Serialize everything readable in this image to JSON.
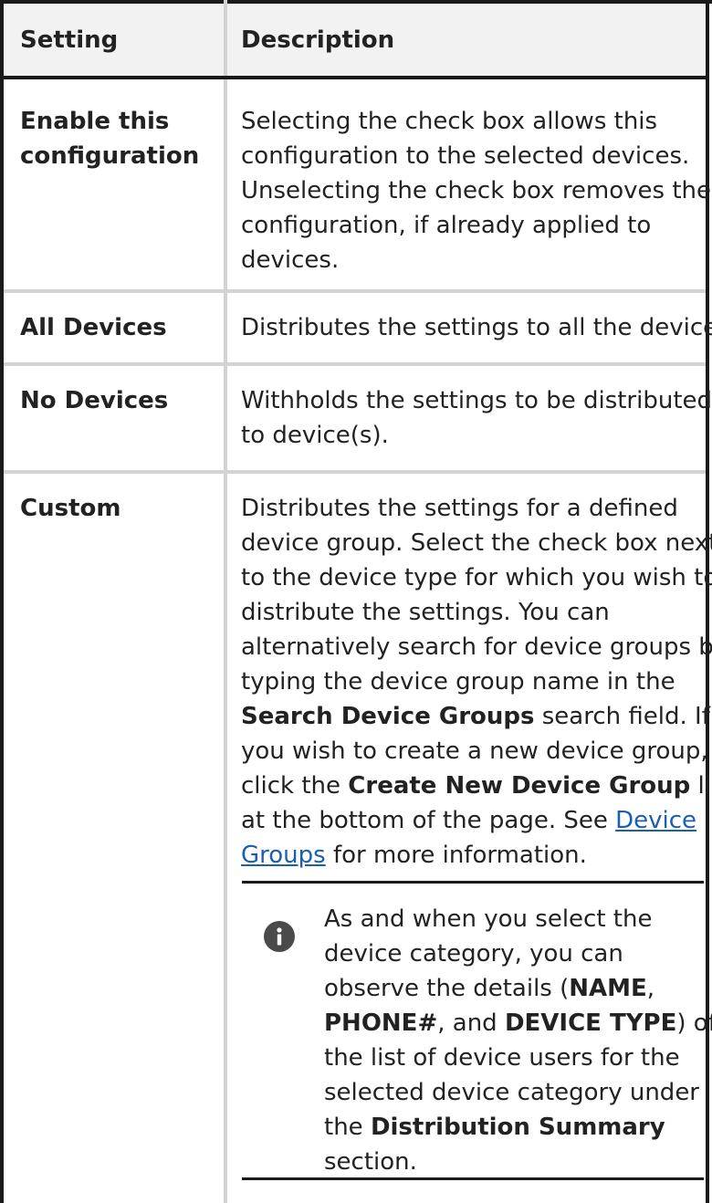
{
  "table": {
    "headers": {
      "setting": "Setting",
      "description": "Description"
    },
    "rows": [
      {
        "setting_lines": [
          "Enable this",
          "configuration"
        ],
        "description_lines": [
          "Selecting the check box allows this",
          "configuration to the selected devices.",
          "Unselecting the check box removes the",
          "configuration, if already applied to",
          "devices."
        ]
      },
      {
        "setting_lines": [
          "All Devices"
        ],
        "description_lines": [
          "Distributes the settings to all the devices."
        ]
      },
      {
        "setting_lines": [
          "No Devices"
        ],
        "description_lines": [
          "Withholds the settings to be distributed",
          "to device(s)."
        ]
      },
      {
        "setting_lines": [
          "Custom"
        ],
        "description": {
          "l1": "Distributes the settings for a defined",
          "l2": "device group. Select the check box next",
          "l3": "to the device type for which you wish to",
          "l4": "distribute the settings. You can",
          "l5": "alternatively search for device groups by",
          "l6": "typing the device group name in the",
          "l7_bold": "Search Device Groups",
          "l7_rest": " search field. If",
          "l8": "you wish to create a new device group,",
          "l9_pre": "click the ",
          "l9_bold": "Create New Device Group",
          "l9_post": " link",
          "l10_pre": "at the bottom of the page. See ",
          "link_part1": "Device",
          "link_part2": "Groups",
          "l11_post": " for more information."
        },
        "note": {
          "icon": "info-icon",
          "n1": "As and when you select the",
          "n2": "device category, you can",
          "n3_pre": "observe the details (",
          "n3_bold": "NAME",
          "n3_post": ",",
          "n4_bold1": "PHONE#",
          "n4_mid": ", and ",
          "n4_bold2": "DEVICE TYPE",
          "n4_post": ") of",
          "n5": "the list of device users for the",
          "n6": "selected device category under",
          "n7_pre": "the ",
          "n7_bold": "Distribution Summary",
          "n8": "section."
        }
      }
    ]
  },
  "colors": {
    "border_dark": "#1a1a1a",
    "border_light": "#d3d3d3",
    "header_bg": "#f2f2f2",
    "link": "#1a5fb4",
    "icon_bg": "#4a4a4a"
  }
}
